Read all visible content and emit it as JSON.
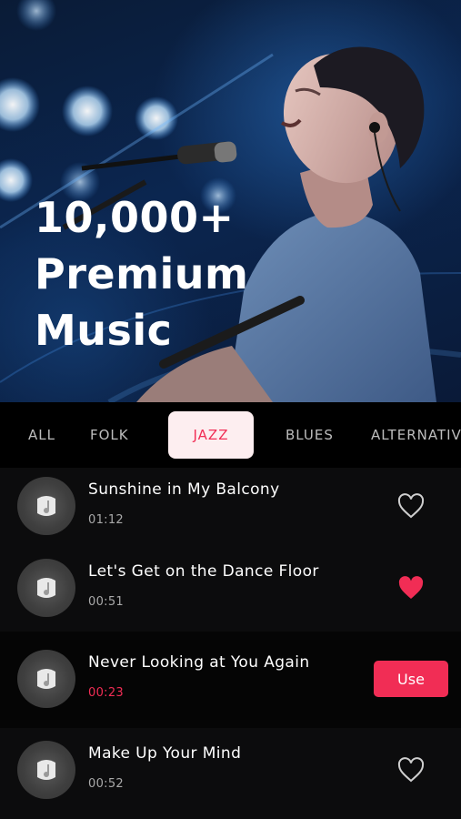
{
  "hero": {
    "title_lines": [
      "10,000+",
      "Premium",
      "Music"
    ]
  },
  "tabs": [
    {
      "label": "ALL",
      "active": false
    },
    {
      "label": "FOLK",
      "active": false
    },
    {
      "label": "JAZZ",
      "active": true
    },
    {
      "label": "BLUES",
      "active": false
    },
    {
      "label": "ALTERNATIVE",
      "active": false
    }
  ],
  "songs": [
    {
      "title": "Sunshine in My Balcony",
      "duration": "01:12",
      "favorited": false,
      "selected": false,
      "icon": "heart-outline-icon"
    },
    {
      "title": "Let's Get on the Dance Floor",
      "duration": "00:51",
      "favorited": true,
      "selected": false,
      "icon": "heart-filled-icon"
    },
    {
      "title": "Never Looking at You Again",
      "duration": "00:23",
      "favorited": false,
      "selected": true,
      "action_label": "Use"
    },
    {
      "title": "Make Up Your Mind",
      "duration": "00:52",
      "favorited": false,
      "selected": false,
      "icon": "heart-outline-icon"
    }
  ],
  "colors": {
    "accent": "#f12d55",
    "active_tab_bg": "#fdeef0",
    "background": "#0c0c0d",
    "tab_bar": "#000000"
  }
}
